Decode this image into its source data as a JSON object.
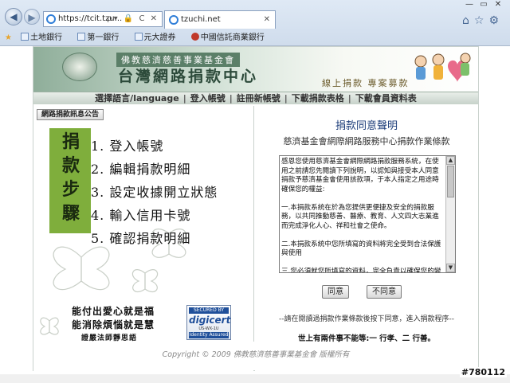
{
  "browser": {
    "address": "https://tcit.tzu...",
    "address_tools": "ρ▾ 🔒 C ✕",
    "tab_title": "tzuchi.net",
    "tab_close": "✕",
    "window_controls": [
      "—",
      "▭",
      "✕"
    ],
    "toolbar_icons": [
      "⌂",
      "☆",
      "⚙"
    ],
    "favorites": [
      "土地銀行",
      "第一銀行",
      "元大證券",
      "中國信託商業銀行"
    ]
  },
  "header": {
    "org_name": "佛教慈濟慈善事業基金會",
    "site_title": "台灣網路捐款中心",
    "slogan": "線上捐款 專案募款"
  },
  "menu": {
    "items": [
      "選擇語言/language",
      "登入帳號",
      "註冊新帳號",
      "下載捐款表格",
      "下載會員資料表"
    ]
  },
  "left": {
    "notice_button": "網路捐款訊息公告",
    "steps_label": "捐款步驟",
    "steps": [
      "1. 登入帳號",
      "2. 編輯捐款明細",
      "3. 設定收據開立狀態",
      "4. 輸入信用卡號",
      "5. 確認捐款明細"
    ],
    "quote_line1": "能付出愛心就是福",
    "quote_line2": "能消除煩惱就是慧",
    "quote_sig": "證嚴法師靜思語",
    "digicert": {
      "secured": "SECURED BY",
      "brand": "digicert",
      "license": "US-WX-1U",
      "identity": "Identity Assured"
    }
  },
  "right": {
    "title": "捐款同意聲明",
    "subtitle": "慈濟基金會網際網路服務中心捐款作業條款",
    "terms": "感恩您使用慈濟基金會網際網路捐款服務系統，在使用之前請您先閱讀下列說明，以認知與接受本人同意捐款予慈濟基金會使用該款項，于本人指定之用途時確保您的權益:\n\n一.本捐款系統在於為您提供更便捷及安全的捐款服務，以共同推動慈善、醫療、教育、人文四大志業進而完成淨化人心、祥和社會之使命。\n\n二.本捐款系統中您所填寫的資料將完全受到合法保護與使用\n\n三.您必須就您所填寫的資料，完全負責以確保您的變",
    "agree_button": "同意",
    "disagree_button": "不同意",
    "hint": "--請在閱讀過捐款作業條款後按下同意，進入捐款程序--",
    "motto": "世上有兩件事不能等:一 行孝、二 行善。"
  },
  "footer": {
    "copyright": "Copyright © 2009 佛教慈濟慈善事業基金會 版權所有"
  },
  "image_id": "#780112",
  "colors": {
    "header_green": "#8fae9a",
    "steps_green": "#7fae3c",
    "title_blue": "#1c3d7a"
  }
}
